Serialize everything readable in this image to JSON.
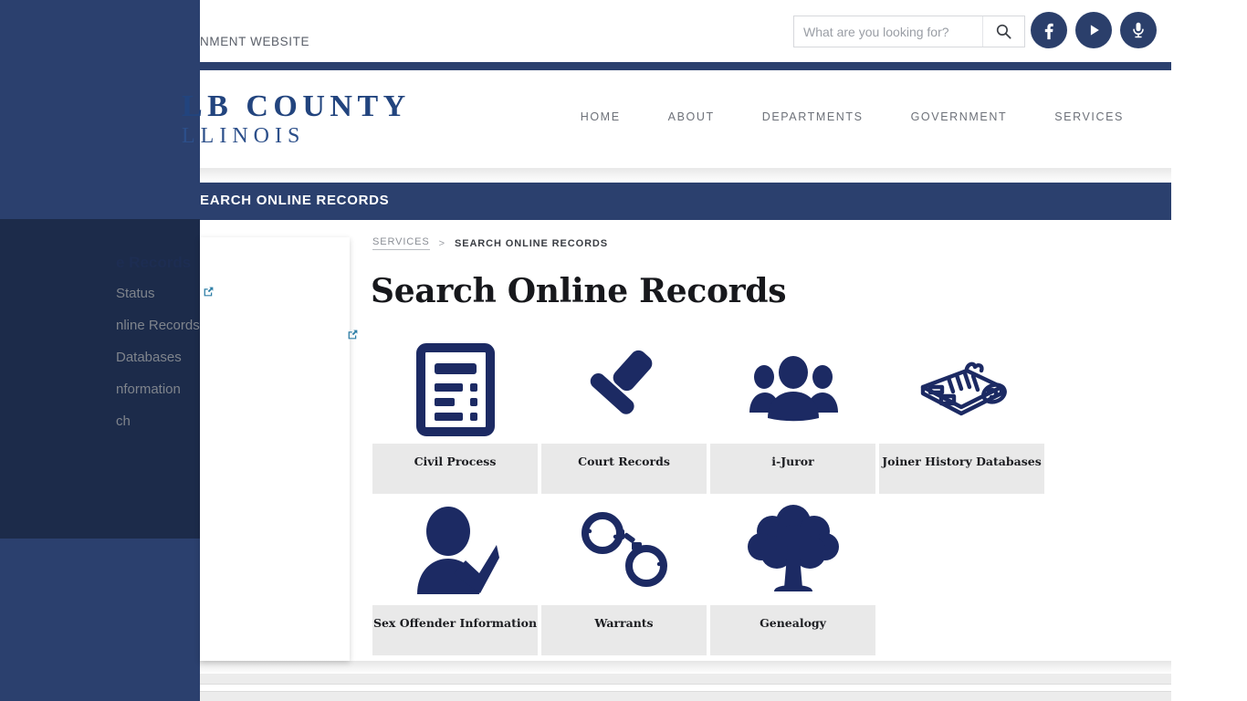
{
  "site": {
    "tagline": "NMENT WEBSITE",
    "logo_main": "LB COUNTY",
    "logo_sub": "LLINOIS",
    "brand_navy": "#2b406e",
    "brand_dark_navy": "#1c2b4a",
    "icon_navy": "#1c2a63"
  },
  "search": {
    "placeholder": "What are you looking for?",
    "value": "",
    "icon": "search-icon"
  },
  "social": [
    {
      "name": "facebook-icon",
      "label": "f"
    },
    {
      "name": "youtube-play-icon",
      "label": "play"
    },
    {
      "name": "podcast-microphone-icon",
      "label": "mic"
    }
  ],
  "nav": {
    "items": [
      {
        "label": "HOME"
      },
      {
        "label": "ABOUT"
      },
      {
        "label": "DEPARTMENTS"
      },
      {
        "label": "GOVERNMENT"
      },
      {
        "label": "SERVICES"
      }
    ]
  },
  "title_band": {
    "text": "EARCH ONLINE RECORDS"
  },
  "breadcrumb": {
    "parent": "SERVICES",
    "separator": ">",
    "current": "SEARCH ONLINE RECORDS"
  },
  "page": {
    "title": "Search Online Records"
  },
  "sidebar": {
    "heading": "e Records",
    "items": [
      {
        "label": "",
        "external": true
      },
      {
        "label": "Status",
        "external": false
      },
      {
        "label": "nline Records",
        "external": true
      },
      {
        "label": "",
        "external": false
      },
      {
        "label": "Databases",
        "external": false
      },
      {
        "label": "nformation",
        "external": false
      },
      {
        "label": "ch",
        "external": false
      }
    ]
  },
  "tiles": {
    "rows": [
      [
        {
          "label": "Civil Process",
          "icon": "document-list-icon"
        },
        {
          "label": "Court Records",
          "icon": "gavel-icon"
        },
        {
          "label": "i-Juror",
          "icon": "people-group-icon"
        },
        {
          "label": "Joiner History Databases",
          "icon": "rolled-newspaper-icon"
        }
      ],
      [
        {
          "label": "Sex Offender Information",
          "icon": "person-check-icon"
        },
        {
          "label": "Warrants",
          "icon": "handcuffs-icon"
        },
        {
          "label": "Genealogy",
          "icon": "tree-icon"
        }
      ]
    ]
  }
}
